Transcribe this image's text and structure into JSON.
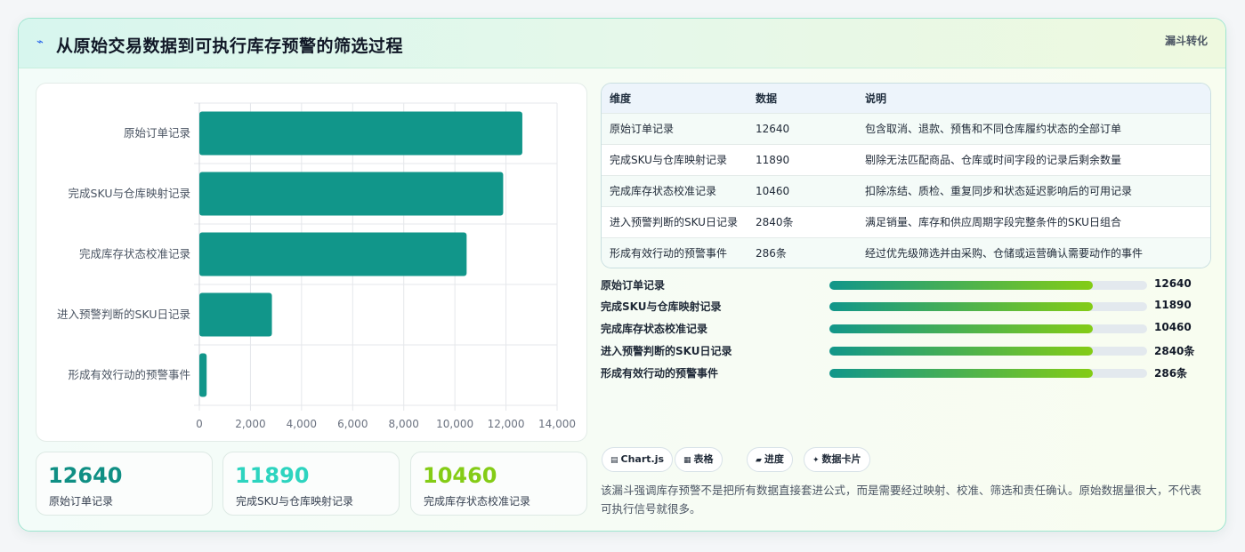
{
  "header": {
    "logo_glyph": "⌁",
    "title": "从原始交易数据到可执行库存预警的筛选过程",
    "tag": "漏斗转化"
  },
  "chart_data": {
    "type": "bar",
    "orientation": "horizontal",
    "categories": [
      "原始订单记录",
      "完成SKU与仓库映射记录",
      "完成库存状态校准记录",
      "进入预警判断的SKU日记录",
      "形成有效行动的预警事件"
    ],
    "values": [
      12640,
      11890,
      10460,
      2840,
      286
    ],
    "xlim": [
      0,
      14000
    ],
    "xticks": [
      "0",
      "2,000",
      "4,000",
      "6,000",
      "8,000",
      "10,000",
      "12,000",
      "14,000"
    ],
    "grid": true,
    "bar_color": "#11968a"
  },
  "kpis": [
    {
      "value": "12640",
      "label": "原始订单记录",
      "color": "#0f8f84"
    },
    {
      "value": "11890",
      "label": "完成SKU与仓库映射记录",
      "color": "#2dd4bf"
    },
    {
      "value": "10460",
      "label": "完成库存状态校准记录",
      "color": "#84cc16"
    }
  ],
  "table": {
    "headers": [
      "维度",
      "数据",
      "说明"
    ],
    "rows": [
      [
        "原始订单记录",
        "12640",
        "包含取消、退款、预售和不同仓库履约状态的全部订单"
      ],
      [
        "完成SKU与仓库映射记录",
        "11890",
        "剔除无法匹配商品、仓库或时间字段的记录后剩余数量"
      ],
      [
        "完成库存状态校准记录",
        "10460",
        "扣除冻结、质检、重复同步和状态延迟影响后的可用记录"
      ],
      [
        "进入预警判断的SKU日记录",
        "2840条",
        "满足销量、库存和供应周期字段完整条件的SKU日组合"
      ],
      [
        "形成有效行动的预警事件",
        "286条",
        "经过优先级筛选并由采购、仓储或运营确认需要动作的事件"
      ]
    ]
  },
  "progress": [
    {
      "label": "原始订单记录",
      "value": "12640",
      "fill": 0.83
    },
    {
      "label": "完成SKU与仓库映射记录",
      "value": "11890",
      "fill": 0.83
    },
    {
      "label": "完成库存状态校准记录",
      "value": "10460",
      "fill": 0.83
    },
    {
      "label": "进入预警判断的SKU日记录",
      "value": "2840条",
      "fill": 0.83
    },
    {
      "label": "形成有效行动的预警事件",
      "value": "286条",
      "fill": 0.83
    }
  ],
  "chips": [
    {
      "icon": "▤",
      "label": "Chart.js",
      "icon_name": "chart-icon"
    },
    {
      "icon": "▦",
      "label": "表格",
      "icon_name": "table-icon"
    },
    {
      "icon": "▰",
      "label": "进度",
      "icon_name": "progress-icon"
    },
    {
      "icon": "✦",
      "label": "数据卡片",
      "icon_name": "card-icon"
    }
  ],
  "note": "该漏斗强调库存预警不是把所有数据直接套进公式，而是需要经过映射、校准、筛选和责任确认。原始数据量很大，不代表可执行信号就很多。"
}
